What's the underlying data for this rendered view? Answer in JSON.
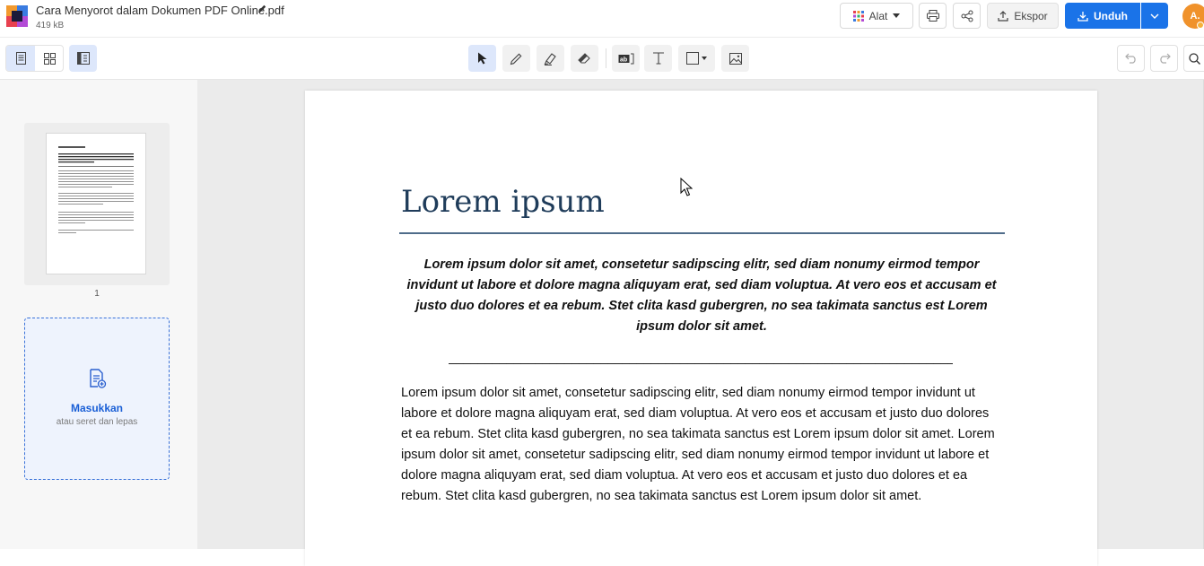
{
  "header": {
    "file_name": "Cara Menyorot dalam Dokumen PDF Online.pdf",
    "file_size": "419 kB",
    "tools_label": "Alat",
    "export_label": "Ekspor",
    "download_label": "Unduh",
    "avatar_initial": "A."
  },
  "sidebar": {
    "page_number": "1",
    "drop_title": "Masukkan",
    "drop_subtitle": "atau seret dan lepas"
  },
  "document": {
    "title": "Lorem ipsum",
    "lead": "Lorem ipsum dolor sit amet, consetetur sadipscing elitr, sed diam nonumy eirmod tempor invidunt ut labore et dolore magna aliquyam erat, sed diam voluptua. At vero eos et accusam et justo duo dolores et ea rebum. Stet clita kasd gubergren, no sea takimata sanctus est Lorem ipsum dolor sit amet.",
    "underline": "________________________________________________________________________________________",
    "body": "Lorem ipsum dolor sit amet, consetetur sadipscing elitr, sed diam nonumy eirmod tempor invidunt ut labore et dolore magna aliquyam erat, sed diam voluptua. At vero eos et accusam et justo duo dolores et ea rebum. Stet clita kasd gubergren, no sea takimata sanctus est Lorem ipsum dolor sit amet. Lorem ipsum dolor sit amet, consetetur sadipscing elitr, sed diam nonumy eirmod tempor invidunt ut labore et dolore magna aliquyam erat, sed diam voluptua. At vero eos et accusam et justo duo dolores et ea rebum. Stet clita kasd gubergren, no sea takimata sanctus est Lorem ipsum dolor sit amet."
  },
  "colors": {
    "accent": "#1a73e8",
    "title": "#1f3c5a",
    "avatar": "#f0922b"
  },
  "icons": {
    "toolbar": [
      "page-view-icon",
      "grid-view-icon",
      "sidebar-toggle-icon",
      "select-cursor-icon",
      "pen-icon",
      "highlighter-icon",
      "eraser-icon",
      "text-recognize-icon",
      "text-tool-icon",
      "shape-icon",
      "image-icon",
      "undo-icon",
      "redo-icon",
      "search-icon"
    ]
  }
}
